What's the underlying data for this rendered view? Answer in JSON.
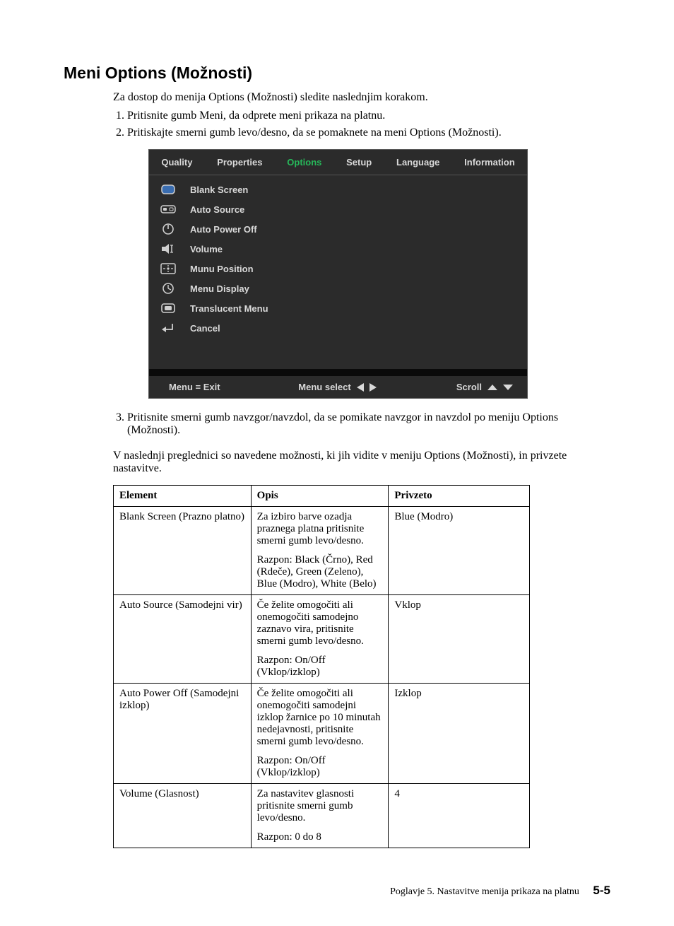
{
  "heading": "Meni Options (Možnosti)",
  "intro": "Za dostop do menija Options (Možnosti) sledite naslednjim korakom.",
  "steps": [
    "Pritisnite gumb Meni, da odprete meni prikaza na platnu.",
    "Pritiskajte smerni gumb levo/desno, da se pomaknete na meni Options (Možnosti)."
  ],
  "osd": {
    "tabs": [
      "Quality",
      "Properties",
      "Options",
      "Setup",
      "Language",
      "Information"
    ],
    "selectedTabIndex": 2,
    "items": [
      {
        "icon": "blank",
        "label": "Blank Screen"
      },
      {
        "icon": "source",
        "label": "Auto Source"
      },
      {
        "icon": "power",
        "label": "Auto Power Off"
      },
      {
        "icon": "volume",
        "label": "Volume"
      },
      {
        "icon": "position",
        "label": "Munu Position"
      },
      {
        "icon": "timer",
        "label": "Menu Display"
      },
      {
        "icon": "translucent",
        "label": "Translucent Menu"
      },
      {
        "icon": "return",
        "label": "Cancel"
      }
    ],
    "footer": {
      "left": "Menu = Exit",
      "mid": "Menu select",
      "right": "Scroll"
    }
  },
  "step3": "Pritisnite smerni gumb navzgor/navzdol, da se pomikate navzgor in navzdol po meniju Options (Možnosti).",
  "preTable": "V naslednji preglednici so navedene možnosti, ki jih vidite v meniju Options (Možnosti), in privzete nastavitve.",
  "table": {
    "headers": [
      "Element",
      "Opis",
      "Privzeto"
    ],
    "rows": [
      {
        "element": "Blank Screen (Prazno platno)",
        "opis1": "Za izbiro barve ozadja praznega platna pritisnite smerni gumb levo/desno.",
        "opis2": "Razpon: Black (Črno), Red (Rdeče), Green (Zeleno), Blue (Modro), White (Belo)",
        "privzeto": "Blue (Modro)"
      },
      {
        "element": "Auto Source (Samodejni vir)",
        "opis1": "Če želite omogočiti ali onemogočiti samodejno zaznavo vira, pritisnite smerni gumb levo/desno.",
        "opis2": "Razpon: On/Off (Vklop/izklop)",
        "privzeto": "Vklop"
      },
      {
        "element": "Auto Power Off (Samodejni izklop)",
        "opis1": "Če želite omogočiti ali onemogočiti samodejni izklop žarnice po 10 minutah nedejavnosti, pritisnite smerni gumb levo/desno.",
        "opis2": "Razpon: On/Off (Vklop/izklop)",
        "privzeto": "Izklop"
      },
      {
        "element": "Volume (Glasnost)",
        "opis1": "Za nastavitev glasnosti pritisnite smerni gumb levo/desno.",
        "opis2": "Razpon: 0 do 8",
        "privzeto": "4"
      }
    ]
  },
  "footer": {
    "chapter": "Poglavje 5. Nastavitve menija prikaza na platnu",
    "page": "5-5"
  }
}
